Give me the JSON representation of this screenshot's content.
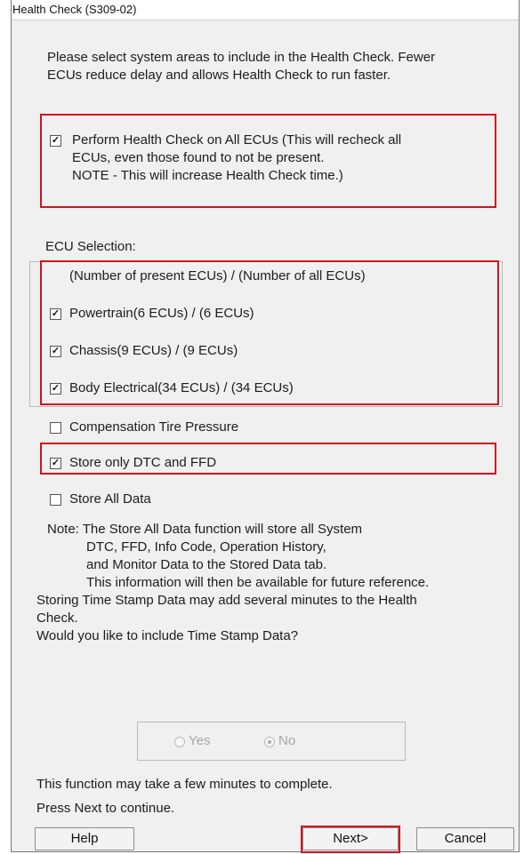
{
  "window": {
    "title": "Health Check (S309-02)"
  },
  "intro": {
    "line1": "Please select system areas to include in the Health Check. Fewer",
    "line2": "ECUs reduce delay and allows Health Check to run faster."
  },
  "all_ecus": {
    "checked": true,
    "line1": "Perform Health Check on All  ECUs (This will recheck all",
    "line2": "ECUs, even those found to not be present.",
    "line3": "NOTE - This will increase Health Check time.)"
  },
  "ecu_selection": {
    "label": "ECU Selection:",
    "header": "(Number of present ECUs) / (Number of all ECUs)",
    "items": [
      {
        "label": "Powertrain(6 ECUs) / (6 ECUs)",
        "checked": true
      },
      {
        "label": "Chassis(9 ECUs) / (9 ECUs)",
        "checked": true
      },
      {
        "label": "Body Electrical(34 ECUs) / (34 ECUs)",
        "checked": true
      }
    ]
  },
  "options": {
    "compensation": {
      "label": "Compensation Tire Pressure",
      "checked": false
    },
    "store_dtc": {
      "label": "Store only DTC and FFD",
      "checked": true
    },
    "store_all": {
      "label": "Store All Data",
      "checked": false
    }
  },
  "note": {
    "line1": "Note: The Store All Data function will store all System",
    "line2": "DTC, FFD, Info Code, Operation History,",
    "line3": "and Monitor Data to the Stored Data tab.",
    "line4": "This information will then be available for future reference.",
    "line5": "Storing Time Stamp Data may add several minutes to the Health",
    "line6": "Check.",
    "line7": "Would you like to include Time Stamp Data?"
  },
  "timestamp_choice": {
    "yes_label": "Yes",
    "no_label": "No",
    "selected": "No"
  },
  "footer": {
    "line1": "This function may take a few minutes to complete.",
    "line2": "Press Next to continue."
  },
  "buttons": {
    "help": "Help",
    "next": "Next>",
    "cancel": "Cancel"
  }
}
